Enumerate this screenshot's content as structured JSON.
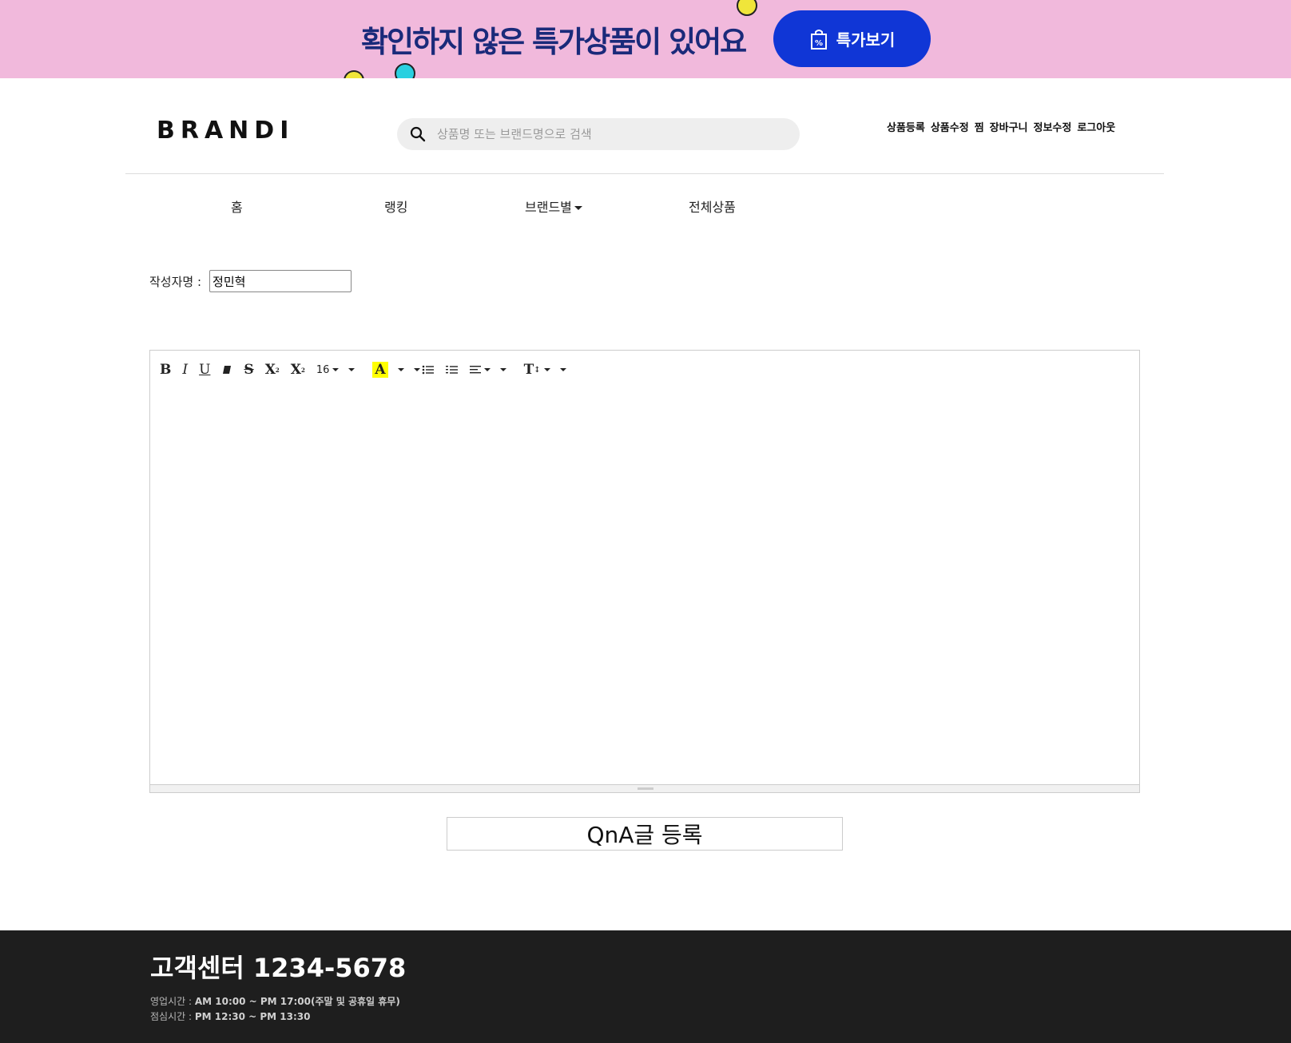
{
  "banner": {
    "text": "확인하지 않은 특가상품이 있어요",
    "button_label": "특가보기"
  },
  "header": {
    "logo": "BRANDI",
    "search_placeholder": "상품명 또는 브랜드명으로 검색",
    "user_menu": [
      "상품등록",
      "상품수정",
      "찜",
      "장바구니",
      "정보수정",
      "로그아웃"
    ]
  },
  "nav": {
    "items": [
      "홈",
      "랭킹",
      "브랜드별",
      "전체상품"
    ]
  },
  "form": {
    "author_label": "작성자명 :",
    "author_value": "정민혁",
    "font_size": "16",
    "submit_label": "QnA글 등록"
  },
  "footer": {
    "cs_title": "고객센터 1234-5678",
    "hours_label": "영업시간 :",
    "hours_value": "AM 10:00 ~ PM 17:00(주말 및 공휴일 휴무)",
    "lunch_label": "점심시간 :",
    "lunch_value": "PM 12:30 ~ PM 13:30"
  },
  "colors": {
    "banner_bg": "#f1b9dc",
    "banner_button": "#1036d6",
    "footer_bg": "#1e1e1e"
  }
}
